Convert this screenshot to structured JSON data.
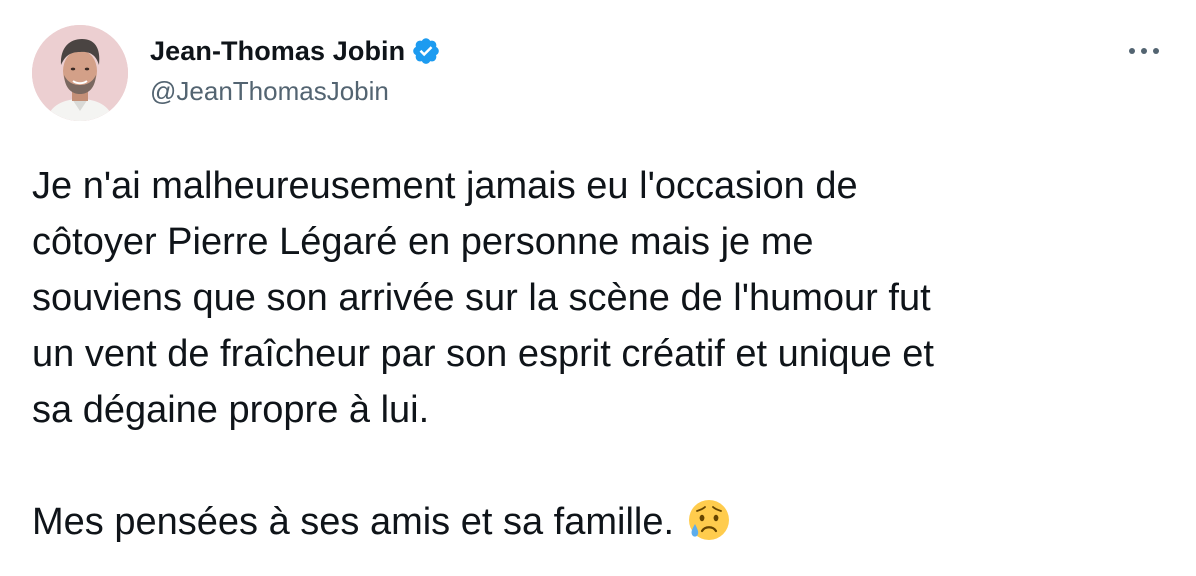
{
  "author": {
    "display_name": "Jean-Thomas Jobin",
    "handle": "@JeanThomasJobin",
    "verified": true,
    "verified_color": "#1d9bf0"
  },
  "icons": {
    "avatar": "profile-photo",
    "verified": "verified-badge-icon",
    "more": "more-options-icon",
    "emoji": "sad-but-relieved-face-emoji"
  },
  "tweet": {
    "lines": [
      "Je n'ai malheureusement jamais eu l'occasion de",
      "côtoyer Pierre Légaré en personne mais je me",
      "souviens que son arrivée sur la scène de l'humour fut",
      "un vent de fraîcheur par son esprit créatif et unique et",
      "sa dégaine propre à lui."
    ],
    "closing": "Mes pensées à ses amis et sa famille."
  },
  "colors": {
    "text": "#0f1419",
    "secondary": "#536471",
    "background": "#ffffff"
  }
}
